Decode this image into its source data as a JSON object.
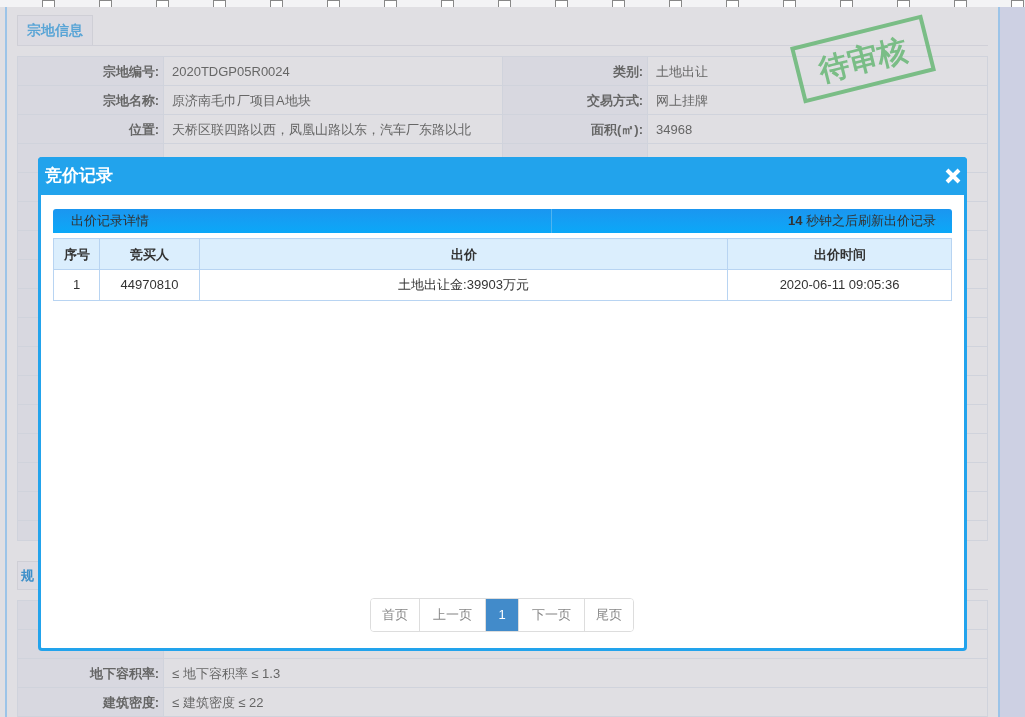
{
  "land_section": {
    "tab": "宗地信息",
    "stamp": "待审核",
    "rows": [
      {
        "label_1": "宗地编号:",
        "value_1": "2020TDGP05R0024",
        "label_2": "类别:",
        "value_2": "土地出让"
      },
      {
        "label_1": "宗地名称:",
        "value_1": "原济南毛巾厂项目A地块",
        "label_2": "交易方式:",
        "value_2": "网上挂牌"
      },
      {
        "label_1": "位置:",
        "value_1": "天桥区联四路以西，凤凰山路以东，汽车厂东路以北",
        "label_2": "面积(㎡):",
        "value_2": "34968"
      }
    ]
  },
  "planning_section": {
    "tab": "规",
    "rows": [
      {
        "label": "地下容积率:",
        "value": "≤ 地下容积率 ≤ 1.3"
      },
      {
        "label": "建筑密度:",
        "value": "≤ 建筑密度 ≤ 22"
      }
    ]
  },
  "dialog": {
    "title": "竞价记录",
    "panel_title": "出价记录详情",
    "refresh_note": "**14** 秒钟之后刷新出价记录",
    "columns": [
      "序号",
      "竞买人",
      "出价",
      "出价时间"
    ],
    "rows": [
      [
        "1",
        "44970810",
        "土地出让金:39903万元",
        "2020-06-11 09:05:36"
      ]
    ],
    "pagination": [
      {
        "label": "首页",
        "selected": false
      },
      {
        "label": "上一页",
        "selected": false
      },
      {
        "label": "1",
        "selected": true
      },
      {
        "label": "下一页",
        "selected": false
      },
      {
        "label": "尾页",
        "selected": false
      }
    ]
  }
}
